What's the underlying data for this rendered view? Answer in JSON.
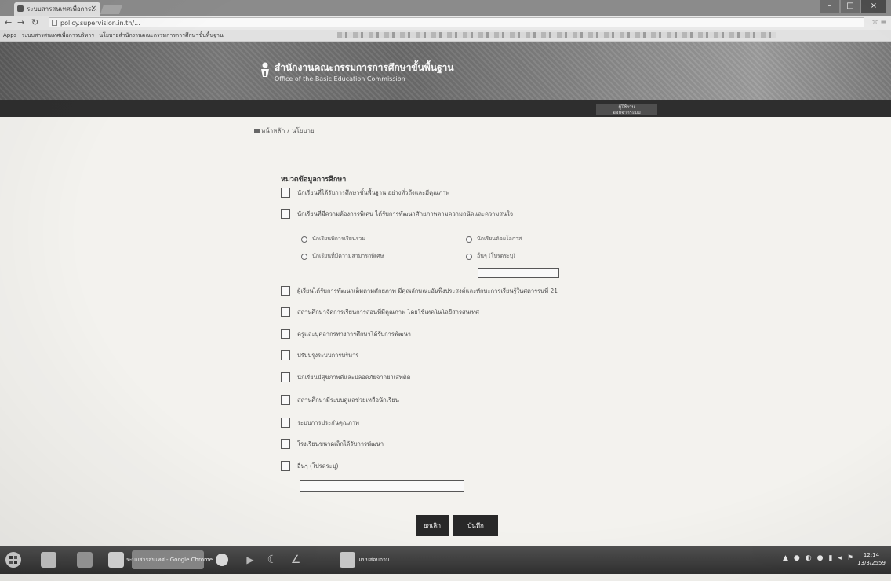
{
  "browser": {
    "tab_title": "ระบบสารสนเทศเพื่อการ...",
    "tab_close": "×",
    "url": "policy.supervision.in.th/...",
    "bookmarks": [
      "Apps",
      "ระบบสารสนเทศเพื่อการบริหาร",
      "นโยบายสำนักงานคณะกรรมการการศึกษาขั้นพื้นฐาน"
    ],
    "window_controls": [
      "–",
      "□",
      "×"
    ]
  },
  "site": {
    "title_th": "สำนักงานคณะกรรมการการศึกษาขั้นพื้นฐาน",
    "title_en": "Office of the Basic Education Commission",
    "user_chip_line1": "ผู้ใช้งาน",
    "user_chip_line2": "ออกจากระบบ"
  },
  "breadcrumb": {
    "home": "หน้าหลัก",
    "separator": "/",
    "current": "นโยบาย"
  },
  "form": {
    "title": "หมวดข้อมูลการศึกษา",
    "items": [
      "นักเรียนที่ได้รับการศึกษาขั้นพื้นฐาน อย่างทั่วถึงและมีคุณภาพ",
      "นักเรียนที่มีความต้องการพิเศษ ได้รับการพัฒนาศักยภาพตามความถนัดและความสนใจ",
      "ผู้เรียนได้รับการพัฒนาเต็มตามศักยภาพ มีคุณลักษณะอันพึงประสงค์และทักษะการเรียนรู้ในศตวรรษที่ 21",
      "สถานศึกษาจัดการเรียนการสอนที่มีคุณภาพ โดยใช้เทคโนโลยีสารสนเทศ",
      "ครูและบุคลากรทางการศึกษาได้รับการพัฒนา",
      "ปรับปรุงระบบการบริหาร",
      "นักเรียนมีสุขภาพดีและปลอดภัยจากยาเสพติด",
      "สถานศึกษามีระบบดูแลช่วยเหลือนักเรียน",
      "ระบบการประกันคุณภาพ",
      "โรงเรียนขนาดเล็กได้รับการพัฒนา",
      "อื่นๆ (โปรดระบุ)"
    ],
    "radio_options": [
      "นักเรียนพิการเรียนร่วม",
      "นักเรียนด้อยโอกาส",
      "นักเรียนที่มีความสามารถพิเศษ",
      "อื่นๆ (โปรดระบุ)"
    ],
    "radio_other_value": "",
    "other_value": "",
    "cancel_label": "ยกเลิก",
    "save_label": "บันทึก"
  },
  "taskbar": {
    "active_window": "ระบบสารสนเทศ - Google Chrome",
    "second_window": "แบบสอบถาม",
    "clock_time": "12:14",
    "clock_date": "13/3/2559"
  }
}
